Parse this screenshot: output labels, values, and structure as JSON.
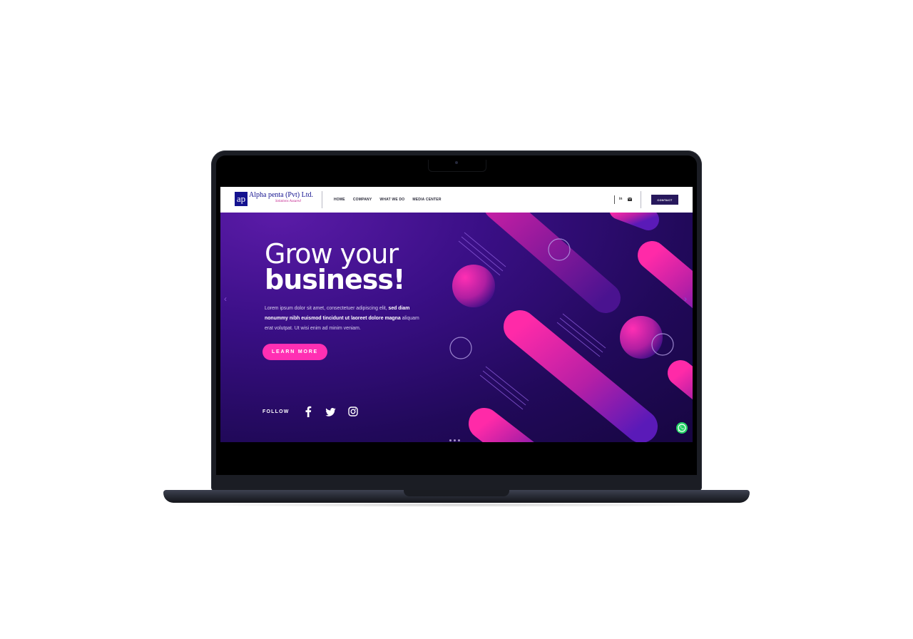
{
  "logo": {
    "mark": "ap",
    "name": "Alpha penta (Pvt) Ltd.",
    "tagline": "Solutions Assured"
  },
  "nav": {
    "items": [
      "HOME",
      "COMPANY",
      "WHAT WE DO",
      "MEDIA CENTER"
    ]
  },
  "header_social": {
    "linkedin": "in",
    "email_icon": "envelope-icon"
  },
  "contact_label": "CONTACT",
  "hero": {
    "title_line1": "Grow your",
    "title_line2": "business!",
    "body_plain": "Lorem ipsum dolor sit amet, consectetuer adipiscing elit, ",
    "body_bold_1": "sed diam nonummy nibh euismod tincidunt ut laoreet dolore magna",
    "body_tail": " aliquam erat volutpat. Ut wisi enim ad minim veniam.",
    "button_label": "LEARN MORE",
    "follow_label": "FOLLOW"
  },
  "colors": {
    "accent": "#ff2fb3",
    "brand_navy": "#14128f",
    "contact_button": "#27185c",
    "hero_bg": "#2a0a6e",
    "whatsapp": "#25d366"
  },
  "icons": [
    "facebook-icon",
    "twitter-icon",
    "instagram-icon",
    "whatsapp-icon",
    "linkedin-icon",
    "envelope-icon",
    "chevron-left-icon",
    "chevron-right-icon"
  ]
}
